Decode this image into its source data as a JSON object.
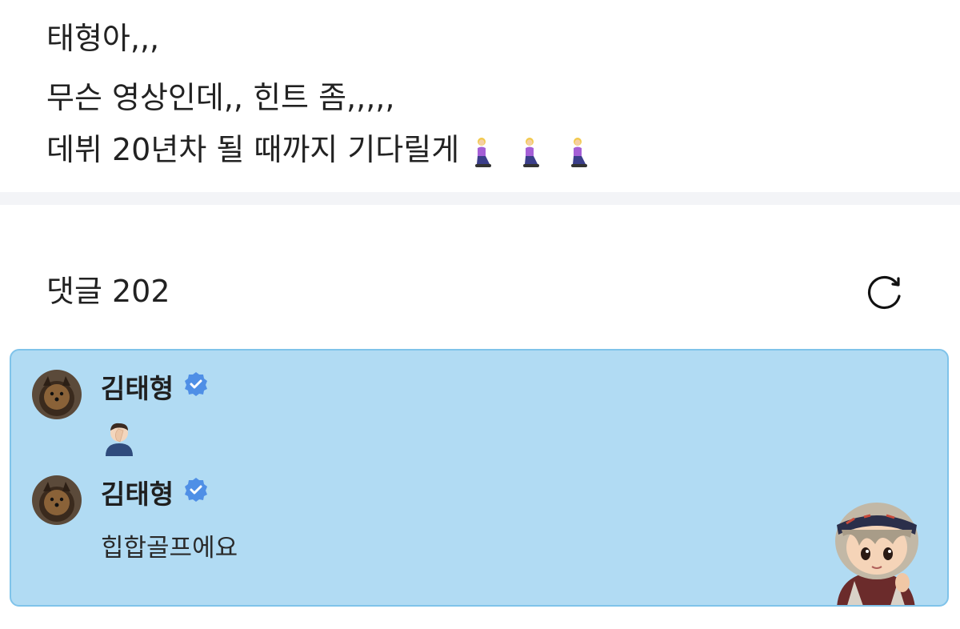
{
  "post": {
    "line1": "태형아,,,",
    "line2": "무슨 영상인데,, 힌트 좀,,,,,",
    "line3": "데뷔 20년차 될 때까지 기다릴게",
    "line3_emojis": [
      "woman-kneeling-emoji",
      "woman-kneeling-emoji",
      "woman-kneeling-emoji"
    ]
  },
  "comments_section": {
    "label": "댓글 202",
    "refresh_icon": "refresh-icon"
  },
  "thread": {
    "background": "#b1dbf3",
    "border": "#7fc3ea",
    "comments": [
      {
        "author": "김태형",
        "verified": true,
        "avatar": "dog-avatar",
        "body_emoji": "man-facepalming-emoji"
      },
      {
        "author": "김태형",
        "verified": true,
        "avatar": "dog-avatar",
        "body": "힙합골프에요"
      }
    ],
    "sticker": "character-sticker"
  },
  "colors": {
    "verified_badge": "#4f8fe6",
    "divider": "#f3f4f7",
    "text": "#222222"
  }
}
